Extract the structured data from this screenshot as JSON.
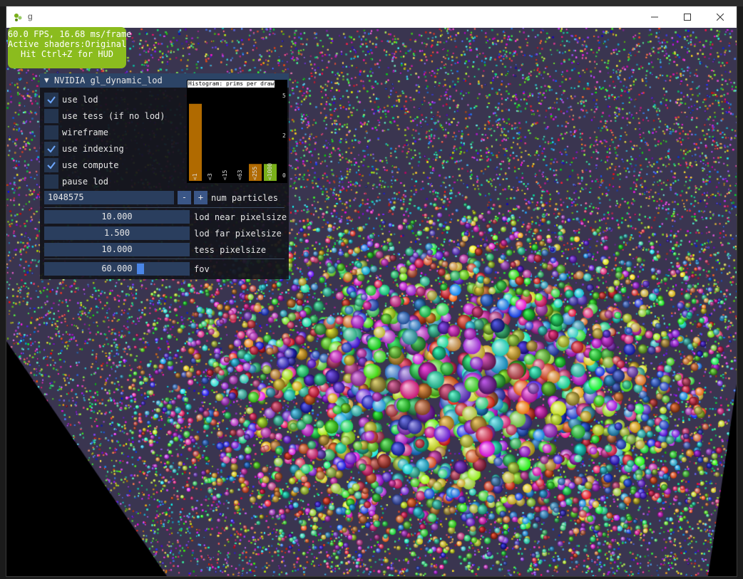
{
  "window": {
    "title": "g"
  },
  "hud": {
    "fps_line": "60.0 FPS, 16.68 ms/frame",
    "shaders_line": "Active shaders:Original",
    "hint_line": "Hit Ctrl+Z for HUD"
  },
  "panel": {
    "title": "NVIDIA gl_dynamic_lod",
    "checkboxes": [
      {
        "label": "use lod",
        "checked": true
      },
      {
        "label": "use tess (if no lod)",
        "checked": false
      },
      {
        "label": "wireframe",
        "checked": false
      },
      {
        "label": "use indexing",
        "checked": true
      },
      {
        "label": "use compute",
        "checked": true
      },
      {
        "label": "pause lod",
        "checked": false
      }
    ],
    "num_particles": {
      "value": "1048575",
      "minus": "-",
      "plus": "+",
      "label": "num particles"
    },
    "sliders": [
      {
        "value": "10.000",
        "label": "lod near pixelsize"
      },
      {
        "value": "1.500",
        "label": "lod far pixelsize"
      },
      {
        "value": "10.000",
        "label": "tess pixelsize"
      }
    ],
    "fov": {
      "value": "60.000",
      "label": "fov"
    },
    "histogram": {
      "title": "Histogram: prims per draw",
      "y_labels": [
        "5",
        "2",
        "0"
      ],
      "bins": [
        {
          "label": "<1",
          "value": 0.82,
          "color": "#b06a00"
        },
        {
          "label": "<3",
          "value": 0.0,
          "color": "#b06a00"
        },
        {
          "label": "<15",
          "value": 0.0,
          "color": "#b06a00"
        },
        {
          "label": "<63",
          "value": 0.0,
          "color": "#b06a00"
        },
        {
          "label": "<255",
          "value": 0.18,
          "color": "#b06a00"
        },
        {
          "label": "<1000",
          "value": 0.18,
          "color": "#7ab01a"
        }
      ]
    }
  },
  "colors": {
    "hud_bg": "#8bbc1e",
    "panel_title_bg": "#2c4466",
    "checkbox_bg": "#24354f",
    "field_bg": "#2a3e5e",
    "accent": "#4a86e8"
  }
}
